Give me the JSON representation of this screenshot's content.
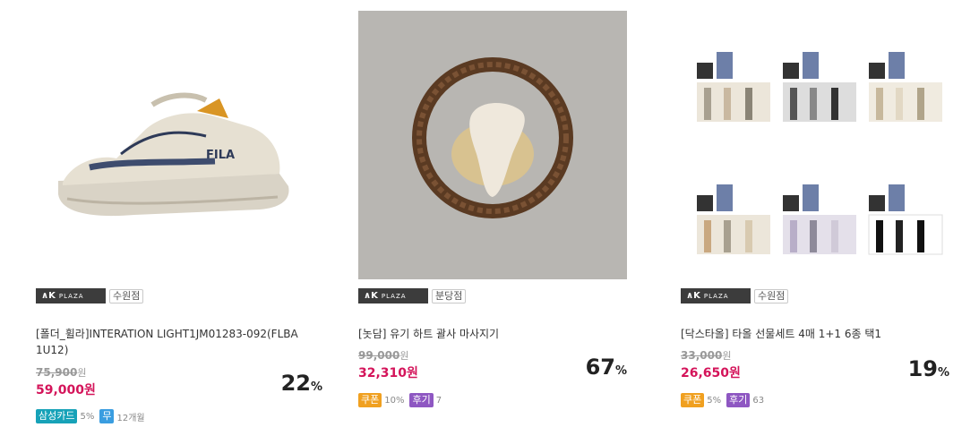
{
  "products": [
    {
      "store_logo": "AK PLAZA",
      "branch": "수원점",
      "title": "[폴더_휠라]INTERATION LIGHT1JM01283-092(FLBA1U12)",
      "original_price": "75,900",
      "sale_price": "59,000원",
      "discount": "22",
      "won": "원",
      "pct": "%",
      "badges": [
        {
          "label": "삼성카드",
          "text": "5%"
        },
        {
          "label": "무",
          "text": "12개월"
        }
      ]
    },
    {
      "store_logo": "AK PLAZA",
      "branch": "분당점",
      "title": "[놋담] 유기 하트 괄사 마사지기",
      "original_price": "99,000",
      "sale_price": "32,310원",
      "discount": "67",
      "won": "원",
      "pct": "%",
      "badges": [
        {
          "label": "쿠폰",
          "text": "10%"
        },
        {
          "label": "후기",
          "text": "7"
        }
      ]
    },
    {
      "store_logo": "AK PLAZA",
      "branch": "수원점",
      "title": "[닥스타올] 타올 선물세트 4매 1+1 6종 택1",
      "original_price": "33,000",
      "sale_price": "26,650원",
      "discount": "19",
      "won": "원",
      "pct": "%",
      "badges": [
        {
          "label": "쿠폰",
          "text": "5%"
        },
        {
          "label": "후기",
          "text": "63"
        }
      ]
    }
  ]
}
